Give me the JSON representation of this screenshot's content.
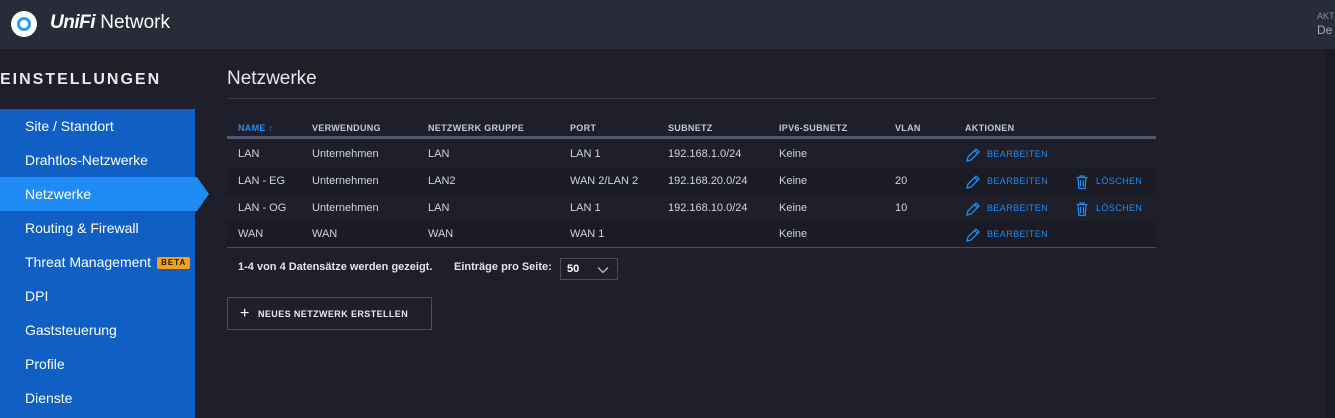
{
  "app": {
    "brand_unifi": "UniFi",
    "brand_network": "Network",
    "top_right_line1": "AKT",
    "top_right_line2": "De"
  },
  "sidebar": {
    "title": "EINSTELLUNGEN",
    "items": [
      {
        "label": "Site / Standort"
      },
      {
        "label": "Drahtlos-Netzwerke"
      },
      {
        "label": "Netzwerke",
        "active": true
      },
      {
        "label": "Routing & Firewall"
      },
      {
        "label": "Threat Management",
        "badge": "BETA"
      },
      {
        "label": "DPI"
      },
      {
        "label": "Gaststeuerung"
      },
      {
        "label": "Profile"
      },
      {
        "label": "Dienste"
      }
    ]
  },
  "page": {
    "title": "Netzwerke"
  },
  "table": {
    "sort_indicator": "↑",
    "headers": {
      "name": "NAME",
      "usage": "VERWENDUNG",
      "group": "NETZWERK GRUPPE",
      "port": "PORT",
      "subnet": "SUBNETZ",
      "ipv6": "IPV6-SUBNETZ",
      "vlan": "VLAN",
      "actions": "AKTIONEN"
    },
    "rows": [
      {
        "name": "LAN",
        "usage": "Unternehmen",
        "group": "LAN",
        "port": "LAN 1",
        "subnet": "192.168.1.0/24",
        "ipv6": "Keine",
        "vlan": "",
        "edit": "BEARBEITEN",
        "delete": ""
      },
      {
        "name": "LAN - EG",
        "usage": "Unternehmen",
        "group": "LAN2",
        "port": "WAN 2/LAN 2",
        "subnet": "192.168.20.0/24",
        "ipv6": "Keine",
        "vlan": "20",
        "edit": "BEARBEITEN",
        "delete": "LÖSCHEN"
      },
      {
        "name": "LAN - OG",
        "usage": "Unternehmen",
        "group": "LAN",
        "port": "LAN 1",
        "subnet": "192.168.10.0/24",
        "ipv6": "Keine",
        "vlan": "10",
        "edit": "BEARBEITEN",
        "delete": "LÖSCHEN"
      },
      {
        "name": "WAN",
        "usage": "WAN",
        "group": "WAN",
        "port": "WAN 1",
        "subnet": "",
        "ipv6": "Keine",
        "vlan": "",
        "edit": "BEARBEITEN",
        "delete": ""
      }
    ]
  },
  "footer": {
    "records_text": "1-4 von 4 Datensätze werden gezeigt.",
    "per_page_label": "Einträge pro Seite:",
    "per_page_value": "50"
  },
  "new_network_button": {
    "plus": "+",
    "label": "NEUES NETZWERK ERSTELLEN"
  },
  "colors": {
    "accent": "#1f8cf5",
    "sidebar": "#0f5fc4",
    "badge": "#f7a11a"
  }
}
